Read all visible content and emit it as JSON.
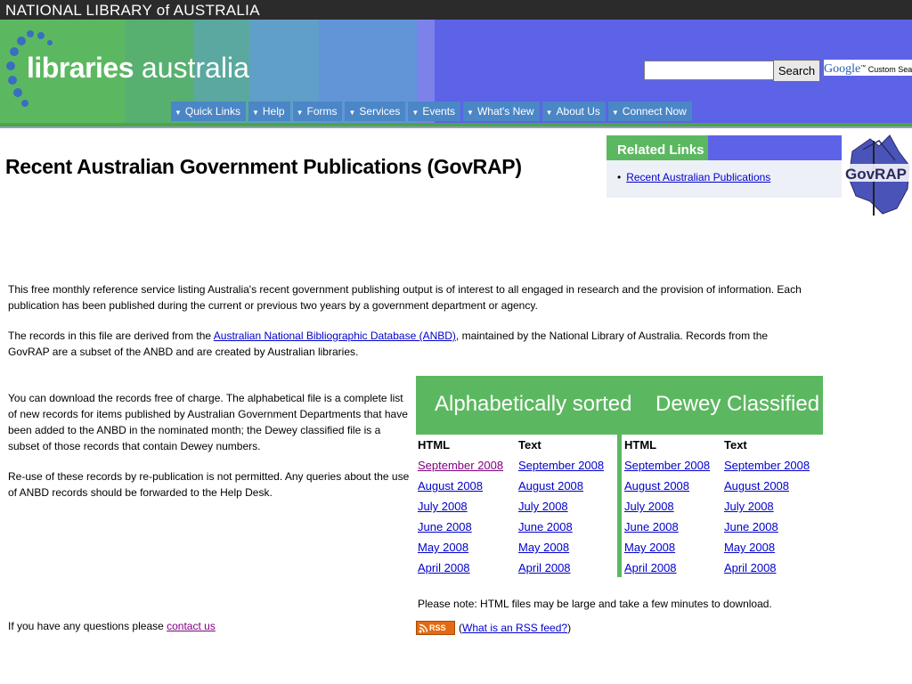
{
  "header": {
    "institution": "NATIONAL LIBRARY of AUSTRALIA",
    "logo_bold": "libraries",
    "logo_light": " australia",
    "search_value": "",
    "search_button": "Search",
    "google_brand": "Google",
    "google_tm": "™",
    "google_custom": " Custom Search"
  },
  "nav": [
    {
      "label": "Quick Links"
    },
    {
      "label": "Help"
    },
    {
      "label": "Forms"
    },
    {
      "label": "Services"
    },
    {
      "label": "Events"
    },
    {
      "label": "What's New"
    },
    {
      "label": "About Us"
    },
    {
      "label": "Connect Now"
    }
  ],
  "page": {
    "title": "Recent Australian Government Publications (GovRAP)"
  },
  "related": {
    "title": "Related Links",
    "items": [
      "Recent Australian Publications"
    ]
  },
  "govrap_logo_text": "GovRAP",
  "intro": {
    "p1": "This free monthly reference service listing Australia's recent government publishing output is of interest to all engaged in research and the provision of information. Each publication has been published during the current or previous two years by a government department or agency.",
    "p2_before": "The records in this file are derived from the ",
    "p2_link": "Australian National Bibliographic Database (ANBD)",
    "p2_after": ", maintained by the National Library of Australia. Records from the GovRAP are a subset of the ANBD and are created by Australian libraries.",
    "p3": "You can download the records free of charge. The alphabetical file is a complete list of new records for items published by Australian Government Departments that have been added to the ANBD in the nominated month; the Dewey classified file is a subset of those records that contain Dewey numbers.",
    "p4": "Re-use of these records by re-publication is not permitted. Any queries about the use of ANBD records should be forwarded to the Help Desk.",
    "contact_before": "If you have any questions please ",
    "contact_link": "contact us"
  },
  "downloads": {
    "alpha_title": "Alphabetically sorted",
    "dewey_title": "Dewey Classified",
    "col_html": "HTML",
    "col_text": "Text",
    "months": [
      "September 2008",
      "August 2008",
      "July 2008",
      "June 2008",
      "May 2008",
      "April 2008"
    ],
    "note": "Please note: HTML files may be large and take a few minutes to download.",
    "rss_badge": "RSS",
    "rss_open": "(",
    "rss_link": "What is an RSS feed?",
    "rss_close": " )"
  }
}
